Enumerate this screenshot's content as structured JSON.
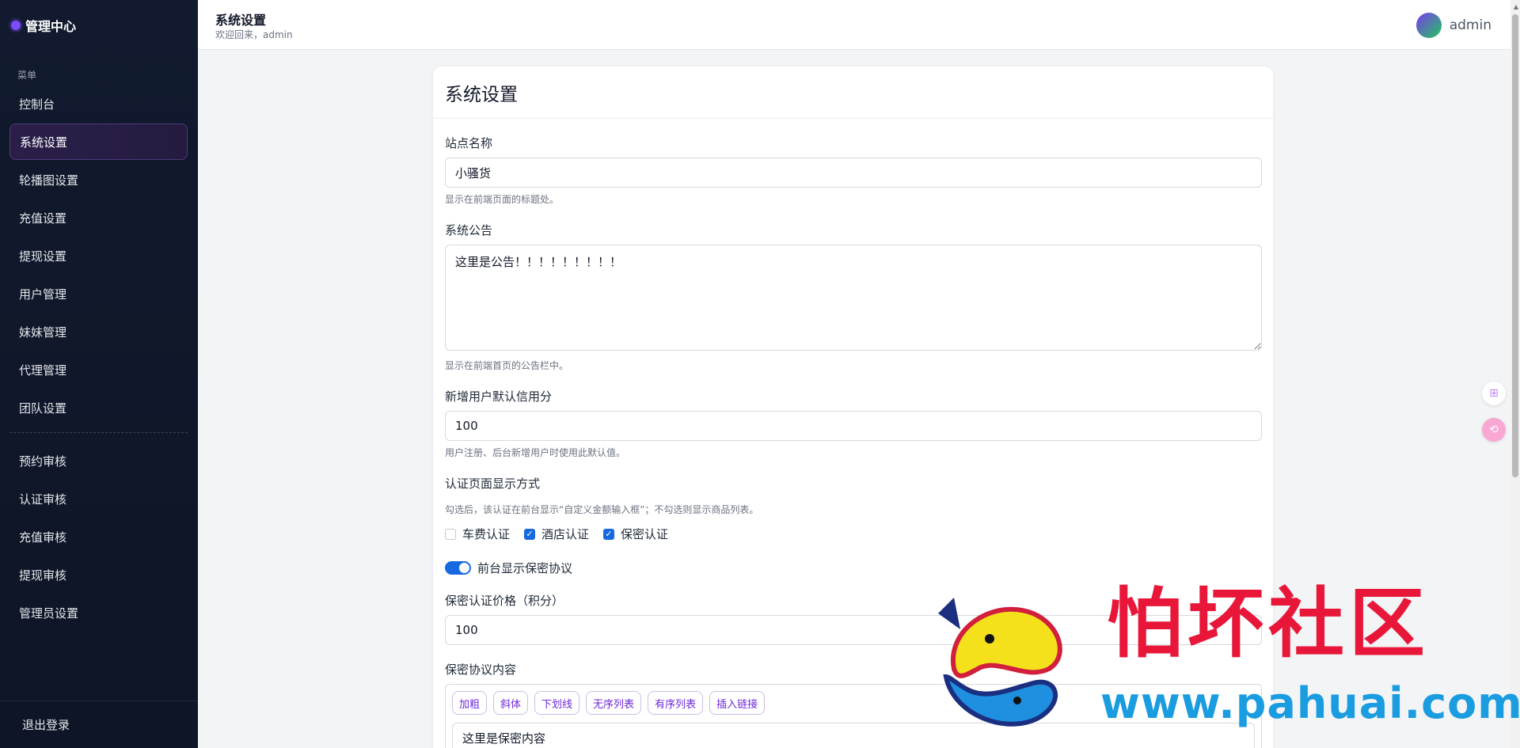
{
  "sidebar": {
    "brand": "管理中心",
    "menu_caption": "菜单",
    "items": [
      {
        "label": "控制台"
      },
      {
        "label": "系统设置"
      },
      {
        "label": "轮播图设置"
      },
      {
        "label": "充值设置"
      },
      {
        "label": "提现设置"
      },
      {
        "label": "用户管理"
      },
      {
        "label": "妹妹管理"
      },
      {
        "label": "代理管理"
      },
      {
        "label": "团队设置"
      }
    ],
    "audit_items": [
      {
        "label": "预约审核"
      },
      {
        "label": "认证审核"
      },
      {
        "label": "充值审核"
      },
      {
        "label": "提现审核"
      },
      {
        "label": "管理员设置"
      }
    ],
    "logout": "退出登录"
  },
  "topbar": {
    "title": "系统设置",
    "subtitle": "欢迎回来，admin",
    "username": "admin"
  },
  "card": {
    "title": "系统设置",
    "site_name": {
      "label": "站点名称",
      "value": "小骚货",
      "hint": "显示在前端页面的标题处。"
    },
    "notice": {
      "label": "系统公告",
      "value": "这里是公告！！！！！！！！！",
      "hint": "显示在前端首页的公告栏中。"
    },
    "credit": {
      "label": "新增用户默认信用分",
      "value": "100",
      "hint": "用户注册、后台新增用户时使用此默认值。"
    },
    "auth_display": {
      "label": "认证页面显示方式",
      "hint": "勾选后，该认证在前台显示“自定义金额输入框”；不勾选则显示商品列表。",
      "options": [
        {
          "label": "车费认证",
          "checked": false
        },
        {
          "label": "酒店认证",
          "checked": true
        },
        {
          "label": "保密认证",
          "checked": true
        }
      ]
    },
    "toggle": {
      "label": "前台显示保密协议",
      "on": true
    },
    "secret_price": {
      "label": "保密认证价格（积分）",
      "value": "100"
    },
    "secret_content": {
      "label": "保密协议内容",
      "toolbar": [
        "加粗",
        "斜体",
        "下划线",
        "无序列表",
        "有序列表",
        "插入链接"
      ],
      "value": "这里是保密内容"
    }
  },
  "watermark": {
    "text": "怕坏社区",
    "url": "www.pahuai.com"
  },
  "colors": {
    "accent": "#1769e0",
    "sidebar_bg": "#111a2e",
    "active_border": "#4c3a7a",
    "toolbar_text": "#6d28d9"
  }
}
